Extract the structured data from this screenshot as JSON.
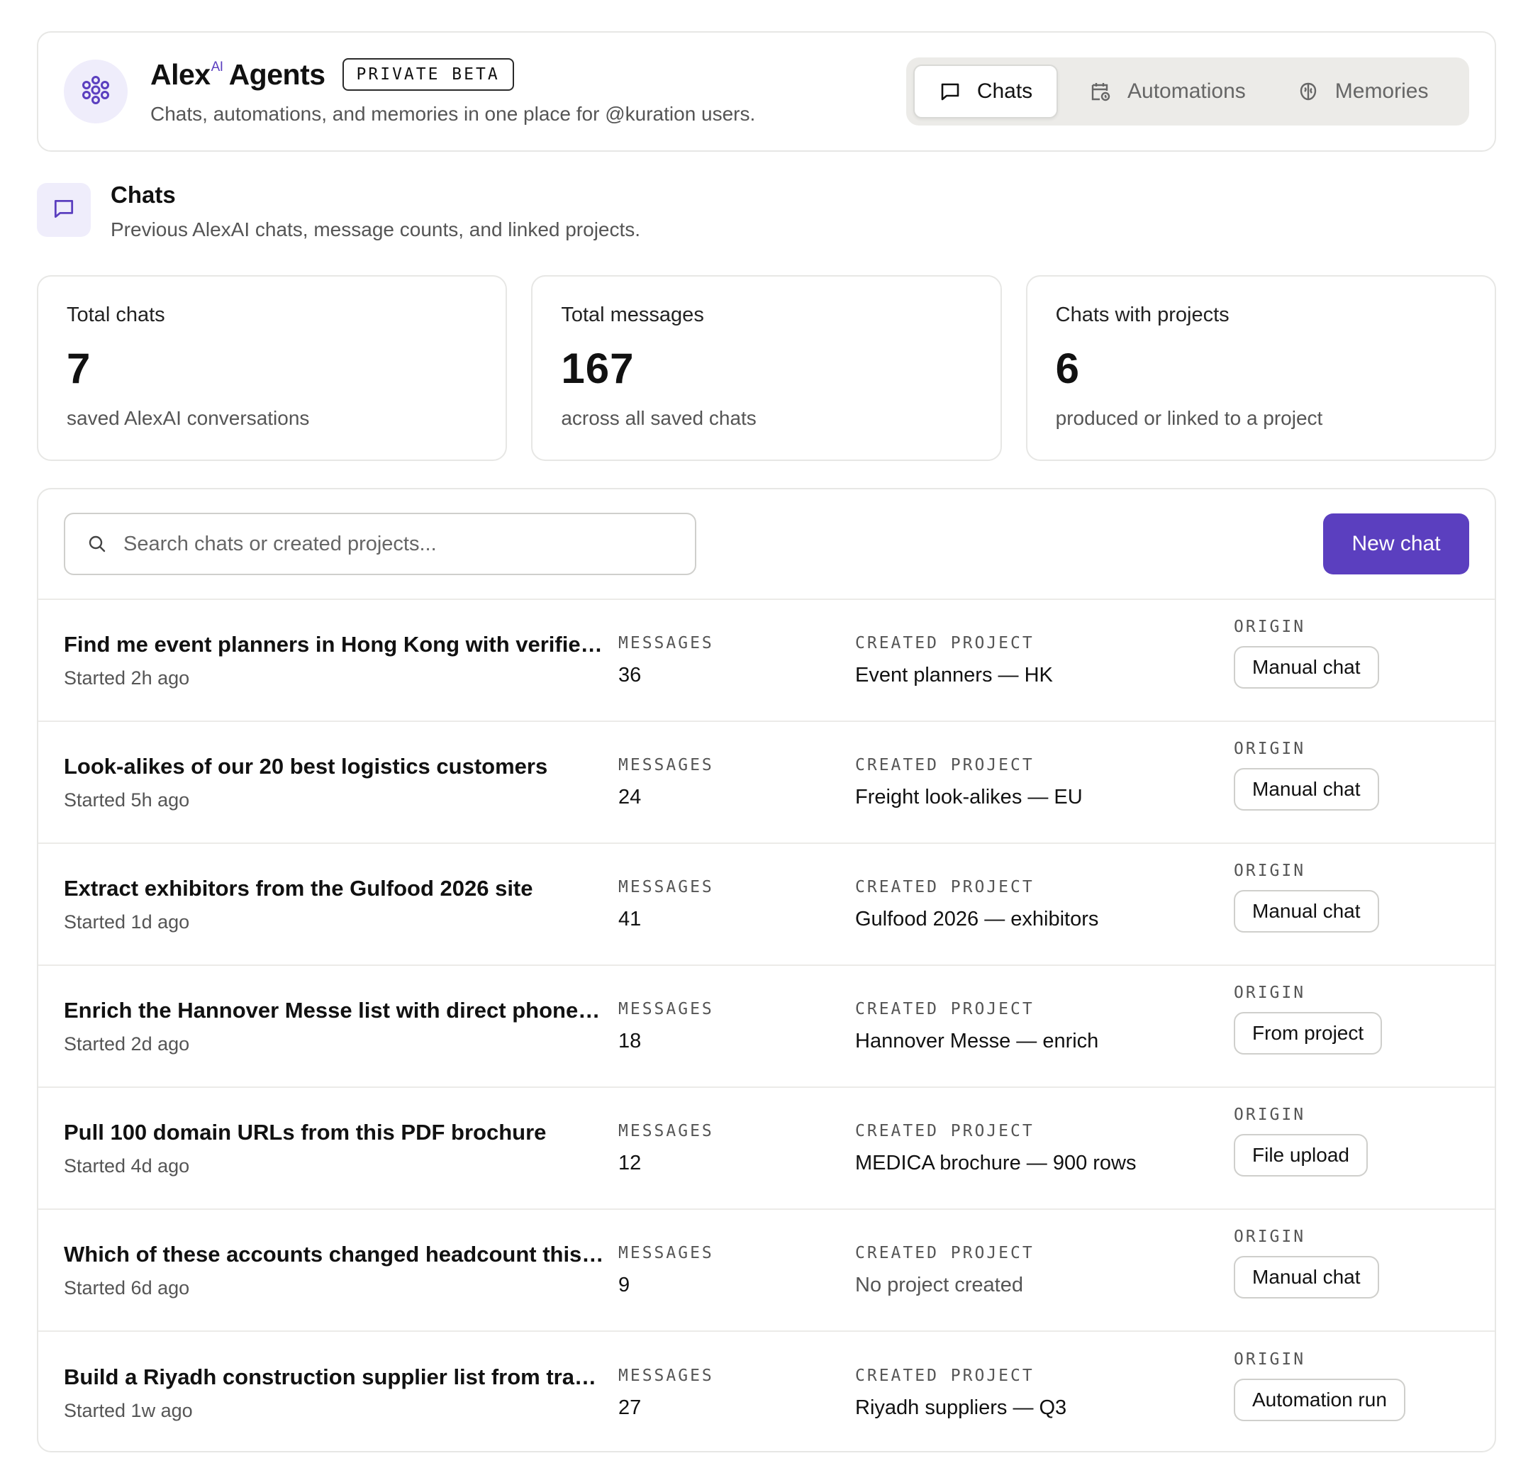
{
  "app": {
    "title": "Alex",
    "title_sup": "AI",
    "title_suffix": "Agents",
    "badge": "PRIVATE BETA",
    "subtitle": "Chats, automations, and memories in one place for @kuration users.",
    "logo_icon": "flower-icon",
    "accent_color": "#5b3fbf"
  },
  "tabs": [
    {
      "label": "Chats",
      "icon": "chat-bubble-icon",
      "active": true
    },
    {
      "label": "Automations",
      "icon": "calendar-clock-icon",
      "active": false
    },
    {
      "label": "Memories",
      "icon": "brain-icon",
      "active": false
    }
  ],
  "section": {
    "title": "Chats",
    "description": "Previous AlexAI chats, message counts, and linked projects.",
    "icon": "chat-bubble-icon"
  },
  "stats": [
    {
      "label": "Total chats",
      "value": "7",
      "sub": "saved AlexAI conversations"
    },
    {
      "label": "Total messages",
      "value": "167",
      "sub": "across all saved chats"
    },
    {
      "label": "Chats with projects",
      "value": "6",
      "sub": "produced or linked to a project"
    }
  ],
  "search": {
    "placeholder": "Search chats or created projects...",
    "value": ""
  },
  "new_chat_label": "New chat",
  "column_labels": {
    "messages": "MESSAGES",
    "project": "CREATED PROJECT",
    "origin": "ORIGIN"
  },
  "chats": [
    {
      "title": "Find me event planners in Hong Kong with verified emails",
      "started": "Started 2h ago",
      "messages": "36",
      "project": "Event planners — HK",
      "origin": "Manual chat"
    },
    {
      "title": "Look-alikes of our 20 best logistics customers",
      "started": "Started 5h ago",
      "messages": "24",
      "project": "Freight look-alikes — EU",
      "origin": "Manual chat"
    },
    {
      "title": "Extract exhibitors from the Gulfood 2026 site",
      "started": "Started 1d ago",
      "messages": "41",
      "project": "Gulfood 2026 — exhibitors",
      "origin": "Manual chat"
    },
    {
      "title": "Enrich the Hannover Messe list with direct phone numbers",
      "started": "Started 2d ago",
      "messages": "18",
      "project": "Hannover Messe — enrich",
      "origin": "From project"
    },
    {
      "title": "Pull 100 domain URLs from this PDF brochure",
      "started": "Started 4d ago",
      "messages": "12",
      "project": "MEDICA brochure — 900 rows",
      "origin": "File upload"
    },
    {
      "title": "Which of these accounts changed headcount this quarter?",
      "started": "Started 6d ago",
      "messages": "9",
      "project": "No project created",
      "origin": "Manual chat"
    },
    {
      "title": "Build a Riyadh construction supplier list from trade directories",
      "started": "Started 1w ago",
      "messages": "27",
      "project": "Riyadh suppliers — Q3",
      "origin": "Automation run"
    }
  ]
}
